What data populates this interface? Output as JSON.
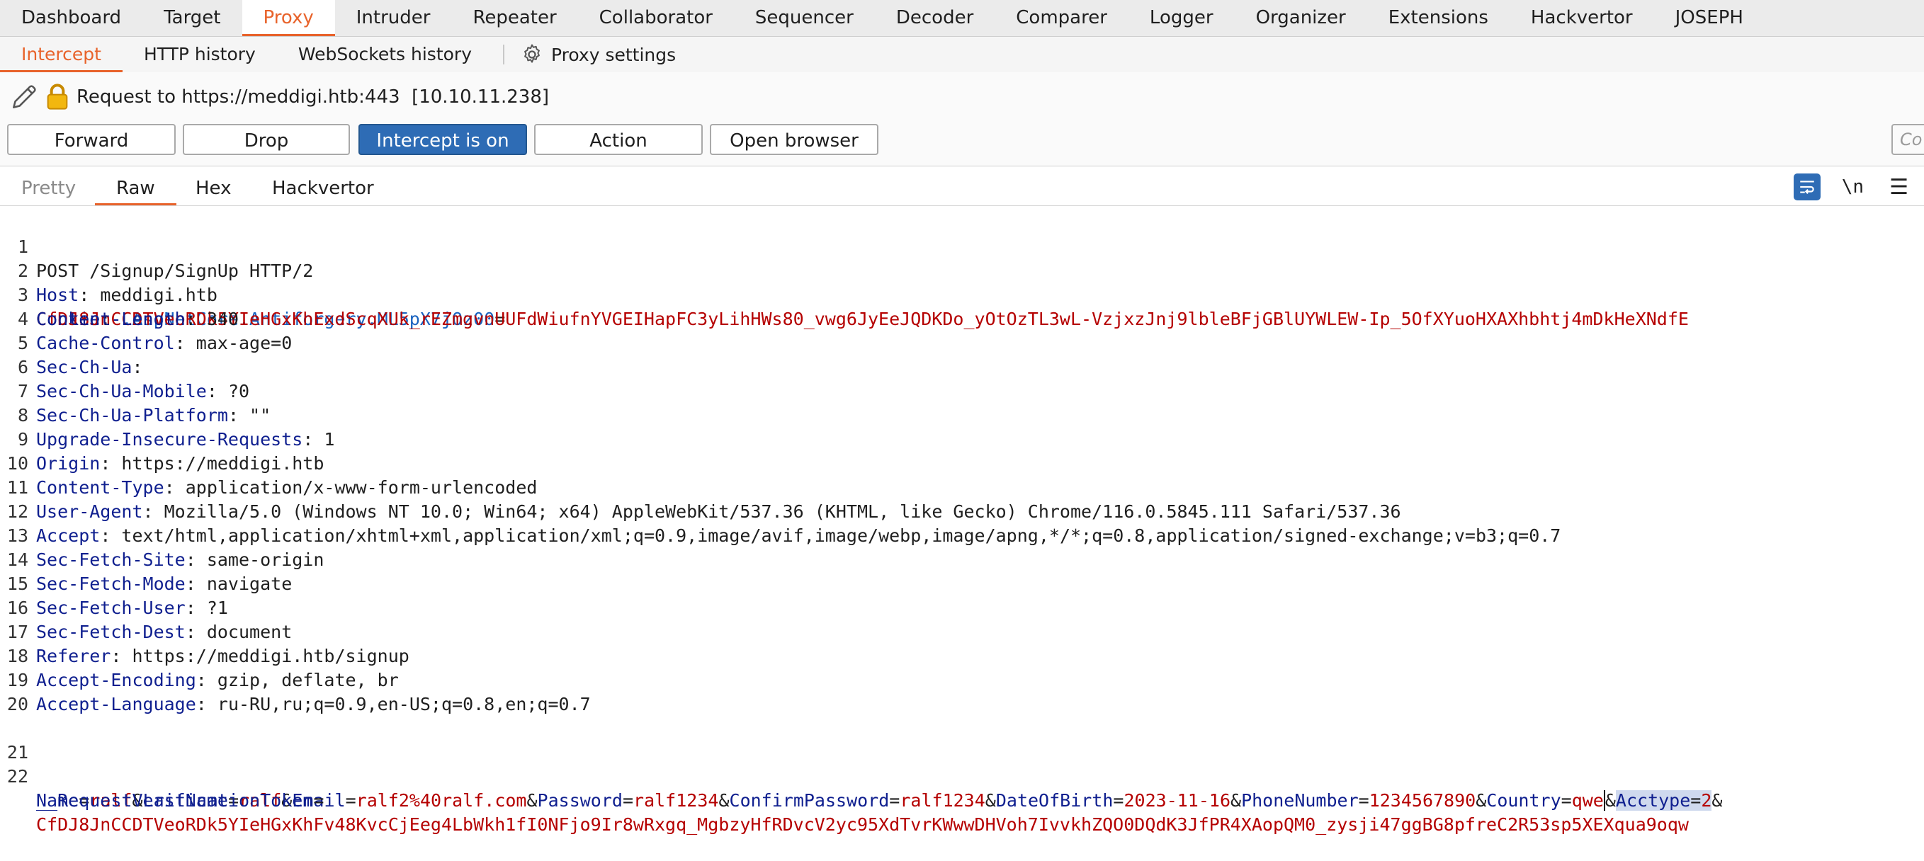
{
  "top_tabs": [
    "Dashboard",
    "Target",
    "Proxy",
    "Intruder",
    "Repeater",
    "Collaborator",
    "Sequencer",
    "Decoder",
    "Comparer",
    "Logger",
    "Organizer",
    "Extensions",
    "Hackvertor",
    "JOSEPH"
  ],
  "sub_tabs": {
    "intercept": "Intercept",
    "http_history": "HTTP history",
    "websockets_history": "WebSockets history",
    "proxy_settings": "Proxy settings"
  },
  "request_info": "Request to https://meddigi.htb:443  [10.10.11.238]",
  "buttons": {
    "forward": "Forward",
    "drop": "Drop",
    "intercept": "Intercept is on",
    "action": "Action",
    "open_browser": "Open browser"
  },
  "comment_placeholder": "Co",
  "editor_tabs": {
    "pretty": "Pretty",
    "raw": "Raw",
    "hex": "Hex",
    "hackvertor": "Hackvertor"
  },
  "editor_tools": {
    "newline": "\\n",
    "menu": "☰"
  },
  "request": {
    "line1": "POST /Signup/SignUp HTTP/2",
    "headers": [
      {
        "n": "2",
        "name": "Host",
        "value": " meddigi.htb"
      },
      {
        "n": "4",
        "name": "Content-Length",
        "value": " 340"
      },
      {
        "n": "5",
        "name": "Cache-Control",
        "value": " max-age=0"
      },
      {
        "n": "6",
        "name": "Sec-Ch-Ua",
        "value": ""
      },
      {
        "n": "7",
        "name": "Sec-Ch-Ua-Mobile",
        "value": " ?0"
      },
      {
        "n": "8",
        "name": "Sec-Ch-Ua-Platform",
        "value": " \"\""
      },
      {
        "n": "9",
        "name": "Upgrade-Insecure-Requests",
        "value": " 1"
      },
      {
        "n": "10",
        "name": "Origin",
        "value": " https://meddigi.htb"
      },
      {
        "n": "11",
        "name": "Content-Type",
        "value": " application/x-www-form-urlencoded"
      },
      {
        "n": "12",
        "name": "User-Agent",
        "value": " Mozilla/5.0 (Windows NT 10.0; Win64; x64) AppleWebKit/537.36 (KHTML, like Gecko) Chrome/116.0.5845.111 Safari/537.36"
      },
      {
        "n": "13",
        "name": "Accept",
        "value": " text/html,application/xhtml+xml,application/xml;q=0.9,image/avif,image/webp,image/apng,*/*;q=0.8,application/signed-exchange;v=b3;q=0.7"
      },
      {
        "n": "14",
        "name": "Sec-Fetch-Site",
        "value": " same-origin"
      },
      {
        "n": "15",
        "name": "Sec-Fetch-Mode",
        "value": " navigate"
      },
      {
        "n": "16",
        "name": "Sec-Fetch-User",
        "value": " ?1"
      },
      {
        "n": "17",
        "name": "Sec-Fetch-Dest",
        "value": " document"
      },
      {
        "n": "18",
        "name": "Referer",
        "value": " https://meddigi.htb/signup"
      },
      {
        "n": "19",
        "name": "Accept-Encoding",
        "value": " gzip, deflate, br"
      },
      {
        "n": "20",
        "name": "Accept-Language",
        "value": " ru-RU,ru;q=0.9,en-US;q=0.8,en;q=0.7"
      }
    ],
    "cookie_header": "Cookie",
    "cookie_name": ".AspNetCore.Antiforgery.ML5pX7jOz00",
    "cookie_value": "CfDJ8JnCCDTVeoRDk5YIeHGxKhExdScqXUk_rEZmgvnUUFdWiufnYVGEIHapFC3yLihHWs80_vwg6JyEeJQDKDo_yOtOzTL3wL-VzjxzJnj9lbleBFjGBlUYWLEW-Ip_5OfXYuoHXAXhbhtj4mDkHeXNdfE",
    "body_params": [
      {
        "name": "Name",
        "value": "ralf"
      },
      {
        "name": "LastName",
        "value": "ralf"
      },
      {
        "name": "Email",
        "value": "ralf2%40ralf.com"
      },
      {
        "name": "Password",
        "value": "ralf1234"
      },
      {
        "name": "ConfirmPassword",
        "value": "ralf1234"
      },
      {
        "name": "DateOfBirth",
        "value": "2023-11-16"
      },
      {
        "name": "PhoneNumber",
        "value": "1234567890"
      },
      {
        "name": "Country",
        "value": "qwe"
      },
      {
        "name": "Acctype",
        "value": "2"
      }
    ],
    "token_name": "__RequestVerificationToken",
    "token_value": "CfDJ8JnCCDTVeoRDk5YIeHGxKhFv48KvcCjEeg4LbWkh1fI0NFjo9Ir8wRxgq_MgbzyHfRDvcV2yc95XdTvrKWwwDHVoh7IvvkhZQO0DQdK3JfPR4XAopQM0_zysji47ggBG8pfreC2R53sp5XEXqua9oqw"
  }
}
